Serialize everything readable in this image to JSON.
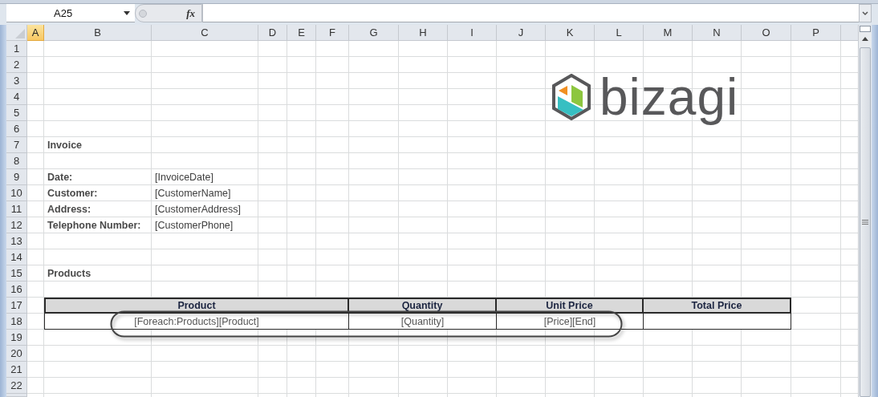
{
  "name_box": {
    "value": "A25"
  },
  "function_label": "fx",
  "columns": [
    {
      "label": "A",
      "selected": true
    },
    {
      "label": "B",
      "selected": false
    },
    {
      "label": "C",
      "selected": false
    },
    {
      "label": "D",
      "selected": false
    },
    {
      "label": "E",
      "selected": false
    },
    {
      "label": "F",
      "selected": false
    },
    {
      "label": "G",
      "selected": false
    },
    {
      "label": "H",
      "selected": false
    },
    {
      "label": "I",
      "selected": false
    },
    {
      "label": "J",
      "selected": false
    },
    {
      "label": "K",
      "selected": false
    },
    {
      "label": "L",
      "selected": false
    },
    {
      "label": "M",
      "selected": false
    },
    {
      "label": "N",
      "selected": false
    },
    {
      "label": "O",
      "selected": false
    },
    {
      "label": "P",
      "selected": false
    }
  ],
  "rows": [
    "1",
    "2",
    "3",
    "4",
    "5",
    "6",
    "7",
    "8",
    "9",
    "10",
    "11",
    "12",
    "13",
    "14",
    "15",
    "16",
    "17",
    "18",
    "19",
    "20",
    "21",
    "22"
  ],
  "logo": {
    "text": "bizagi"
  },
  "invoice": {
    "title": "Invoice",
    "fields": [
      {
        "label": "Date:",
        "value": "[InvoiceDate]"
      },
      {
        "label": "Customer:",
        "value": "[CustomerName]"
      },
      {
        "label": "Address:",
        "value": "[CustomerAddress]"
      },
      {
        "label": "Telephone Number:",
        "value": "[CustomerPhone]"
      }
    ],
    "section": "Products",
    "table": {
      "columns": [
        "Product",
        "Quantity",
        "Unit Price",
        "Total Price"
      ],
      "rows": [
        [
          "[Foreach:Products][Product]",
          "[Quantity]",
          "[Price][End]"
        ]
      ]
    }
  }
}
